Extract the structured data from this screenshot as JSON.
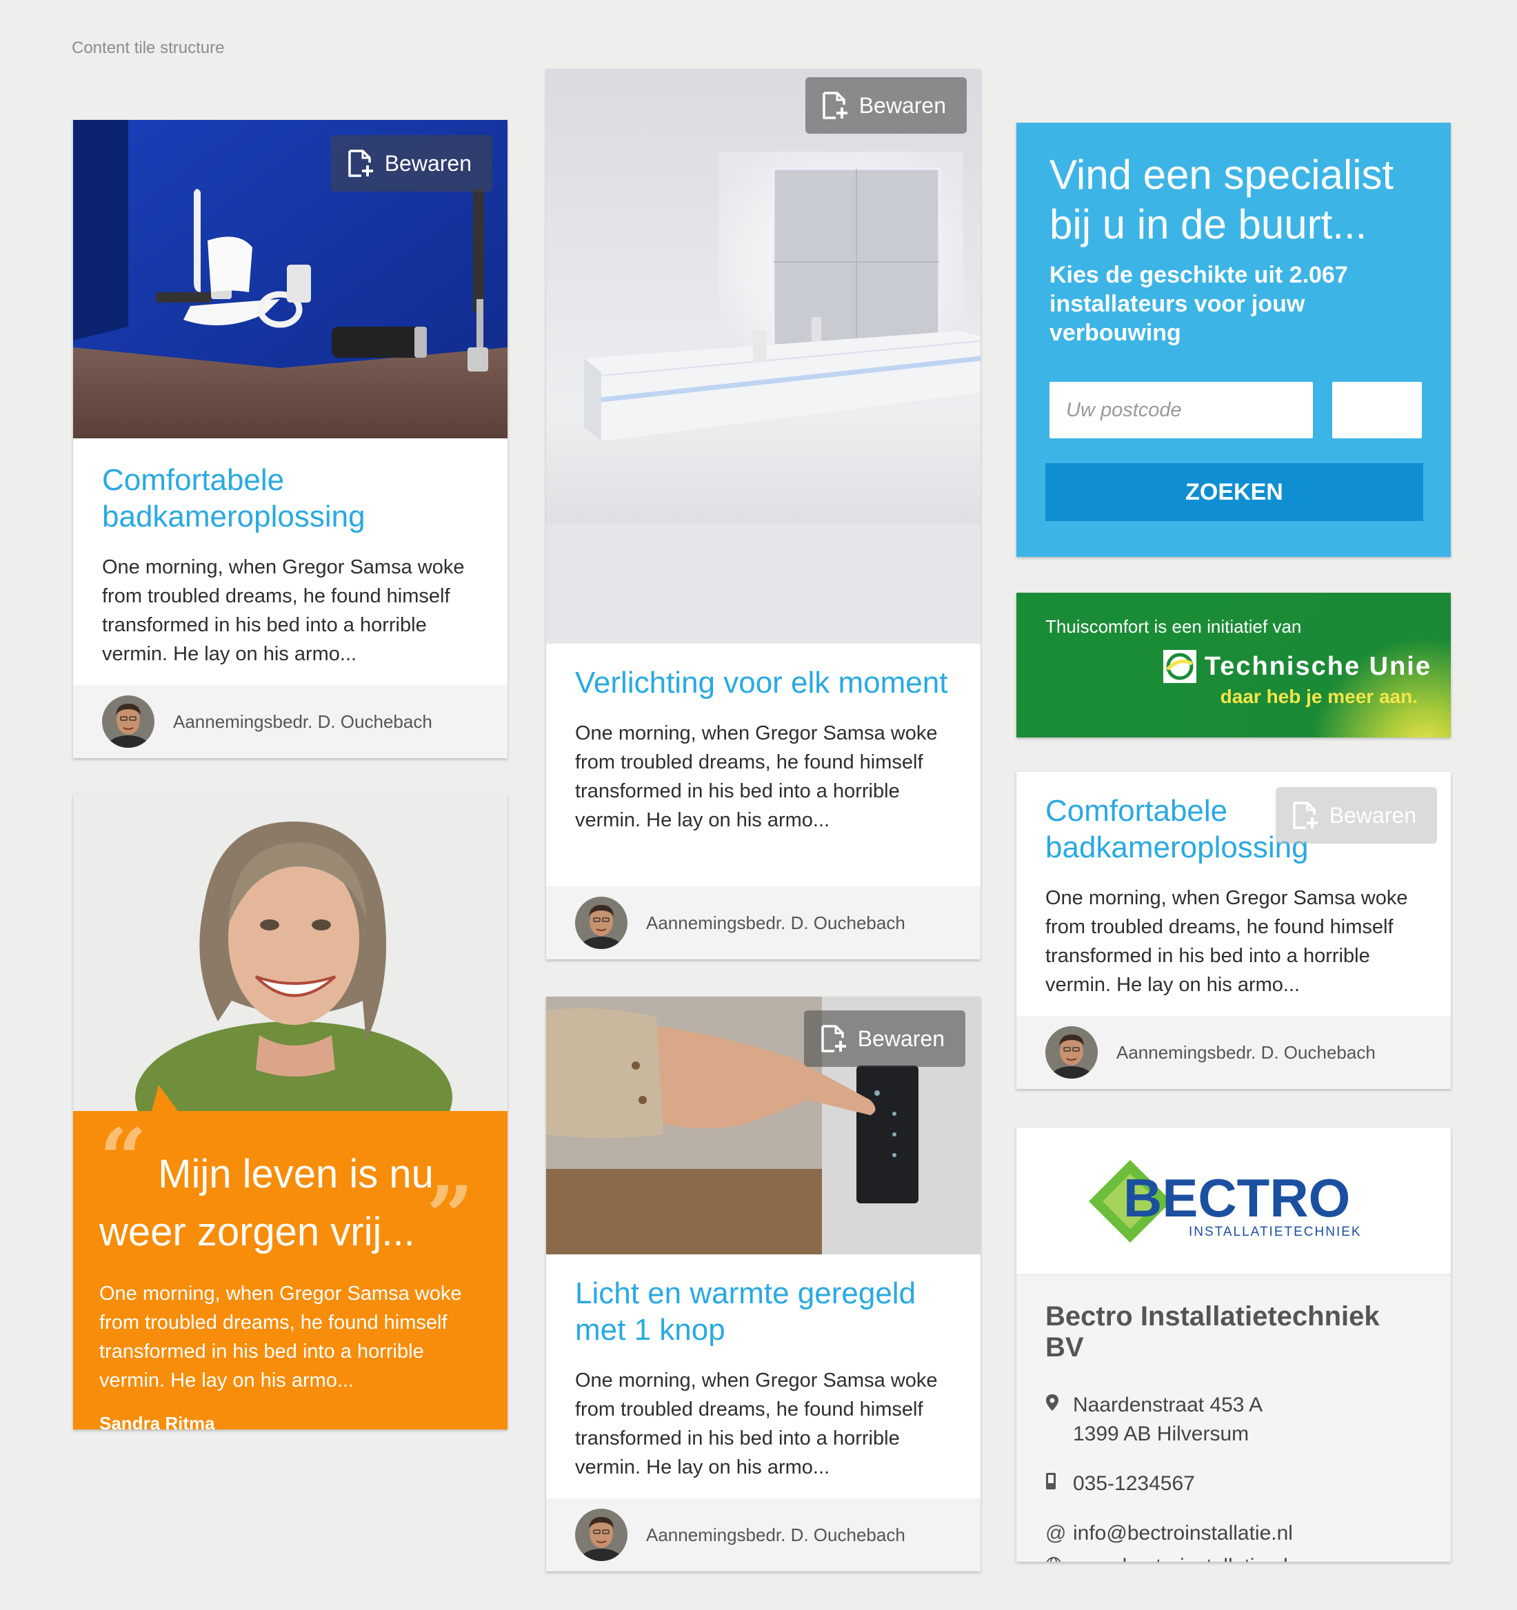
{
  "page": {
    "label": "Content tile structure"
  },
  "save_label": "Bewaren",
  "tiles": {
    "tile1": {
      "title": "Comfortabele badkameroplossing",
      "text": "One morning, when Gregor Samsa woke from troubled dreams, he found himself transformed in his bed into a horrible vermin. He lay on his armo...",
      "author": "Aannemingsbedr. D. Ouchebach"
    },
    "tile2": {
      "title": "Verlichting voor elk moment",
      "text": "One morning, when Gregor Samsa woke from troubled dreams, he found himself transformed in his bed into a horrible vermin. He lay on his armo...",
      "author": "Aannemingsbedr. D. Ouchebach"
    },
    "tile3": {
      "title": "Licht en warmte geregeld met 1 knop",
      "text": "One morning, when Gregor Samsa woke from troubled dreams, he found himself transformed in his bed into a horrible vermin. He lay on his armo...",
      "author": "Aannemingsbedr. D. Ouchebach"
    },
    "tile4": {
      "title": "Comfortabele badkameroplossing",
      "text": "One morning, when Gregor Samsa woke from troubled dreams, he found himself transformed in his bed into a horrible vermin. He lay on his armo...",
      "author": "Aannemingsbedr. D. Ouchebach"
    }
  },
  "quote": {
    "headline": "Mijn leven is nu weer zorgen vrij...",
    "text": "One morning, when Gregor Samsa woke from troubled dreams, he found himself transformed in his bed into a horrible vermin. He lay on his armo...",
    "author": "Sandra Ritma"
  },
  "search": {
    "title": "Vind een specialist bij u in de buurt...",
    "subtitle": "Kies de geschikte uit 2.067 installateurs voor jouw verbouwing",
    "postcode_placeholder": "Uw postcode",
    "button": "ZOEKEN",
    "color": "#3db4e6"
  },
  "banner": {
    "line": "Thuiscomfort is een initiatief van",
    "brand": "Technische Unie",
    "slogan": "daar heb je meer aan."
  },
  "company": {
    "logo_text": "BECTRO",
    "logo_sub": "INSTALLATIETECHNIEK",
    "name": "Bectro Installatietechniek BV",
    "address1": "Naardenstraat 453 A",
    "address2": "1399 AB Hilversum",
    "phone": "035-1234567",
    "email": "info@bectroinstallatie.nl",
    "website": "www.bectroinstallatie.nl"
  },
  "colors": {
    "accent": "#29a9e1",
    "quote": "#f78d0a",
    "background": "#eeeeec"
  }
}
